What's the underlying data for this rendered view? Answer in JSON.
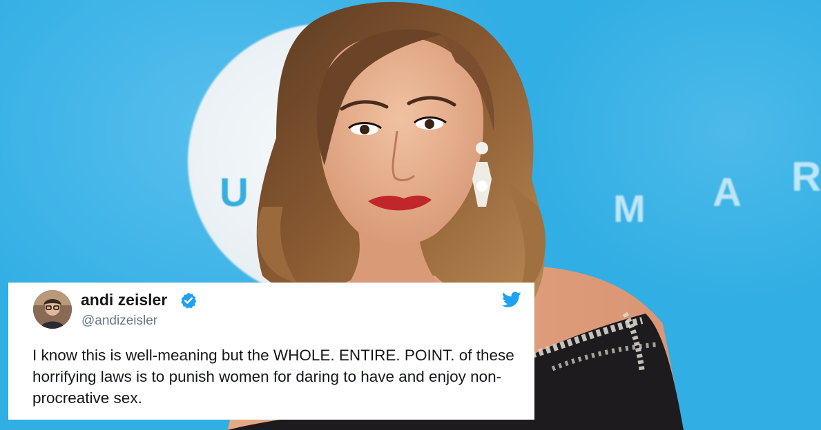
{
  "backdrop": {
    "circle_text": "U",
    "word_letters": [
      "M",
      "A",
      "R"
    ],
    "color": "#31aee4"
  },
  "tweet": {
    "author_name": "andi zeisler",
    "author_handle": "@andizeisler",
    "verified": true,
    "text": "I know this is well-meaning but the WHOLE. ENTIRE. POINT. of these horrifying laws is to punish women for daring to have and enjoy non-procreative sex.",
    "icons": {
      "avatar": "avatar-photo",
      "verified": "verified-badge-icon",
      "platform": "twitter-bird-icon"
    },
    "colors": {
      "verified": "#1da1f2",
      "bird": "#1da1f2",
      "text": "#14171a",
      "handle": "#657786"
    }
  }
}
